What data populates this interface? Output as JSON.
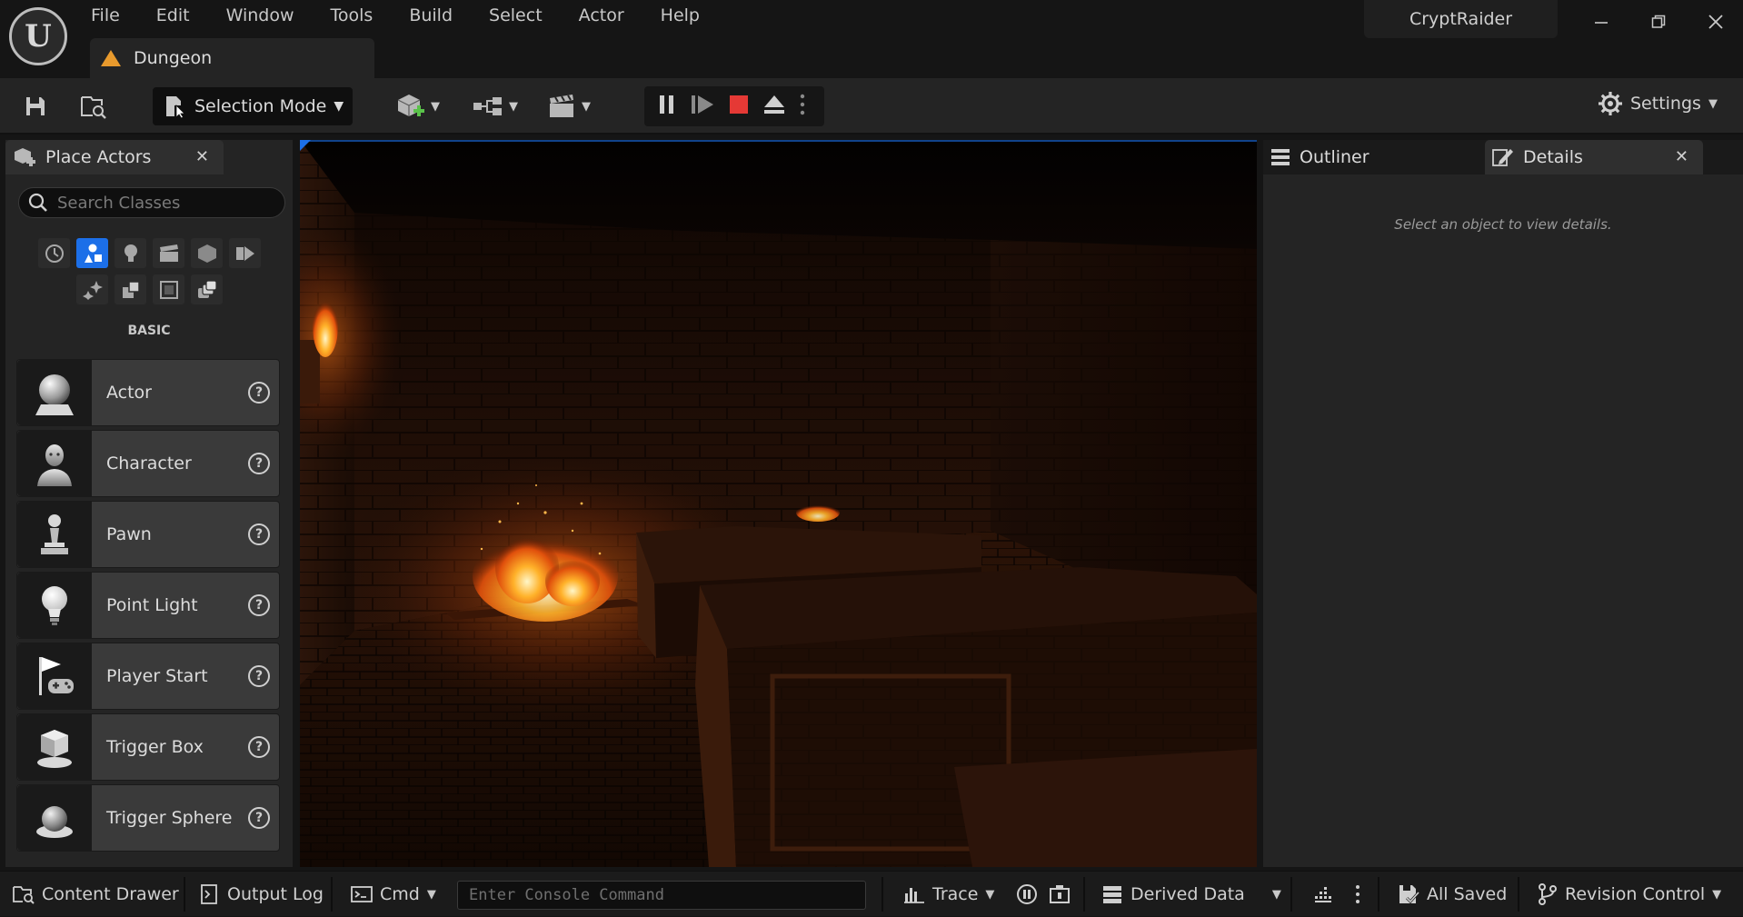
{
  "menu": [
    "File",
    "Edit",
    "Window",
    "Tools",
    "Build",
    "Select",
    "Actor",
    "Help"
  ],
  "level_tab": "Dungeon",
  "project_name": "CryptRaider",
  "toolbar": {
    "selection_mode": "Selection Mode",
    "settings": "Settings"
  },
  "place_actors": {
    "tab_label": "Place Actors",
    "search_placeholder": "Search Classes",
    "category_heading": "BASIC",
    "items": [
      {
        "label": "Actor",
        "icon": "actor-sphere-icon"
      },
      {
        "label": "Character",
        "icon": "character-icon"
      },
      {
        "label": "Pawn",
        "icon": "pawn-icon"
      },
      {
        "label": "Point Light",
        "icon": "light-bulb-icon"
      },
      {
        "label": "Player Start",
        "icon": "player-start-flag-icon"
      },
      {
        "label": "Trigger Box",
        "icon": "trigger-box-icon"
      },
      {
        "label": "Trigger Sphere",
        "icon": "trigger-sphere-icon"
      }
    ]
  },
  "right_panel": {
    "outliner_label": "Outliner",
    "details_label": "Details",
    "hint": "Select an object to view details."
  },
  "statusbar": {
    "content_drawer": "Content Drawer",
    "output_log": "Output Log",
    "cmd": "Cmd",
    "console_placeholder": "Enter Console Command",
    "trace": "Trace",
    "derived_data": "Derived Data",
    "all_saved": "All Saved",
    "revision_control": "Revision Control"
  },
  "colors": {
    "accent": "#1c6fe8",
    "stop": "#e53935",
    "level_icon": "#e89a2d"
  }
}
